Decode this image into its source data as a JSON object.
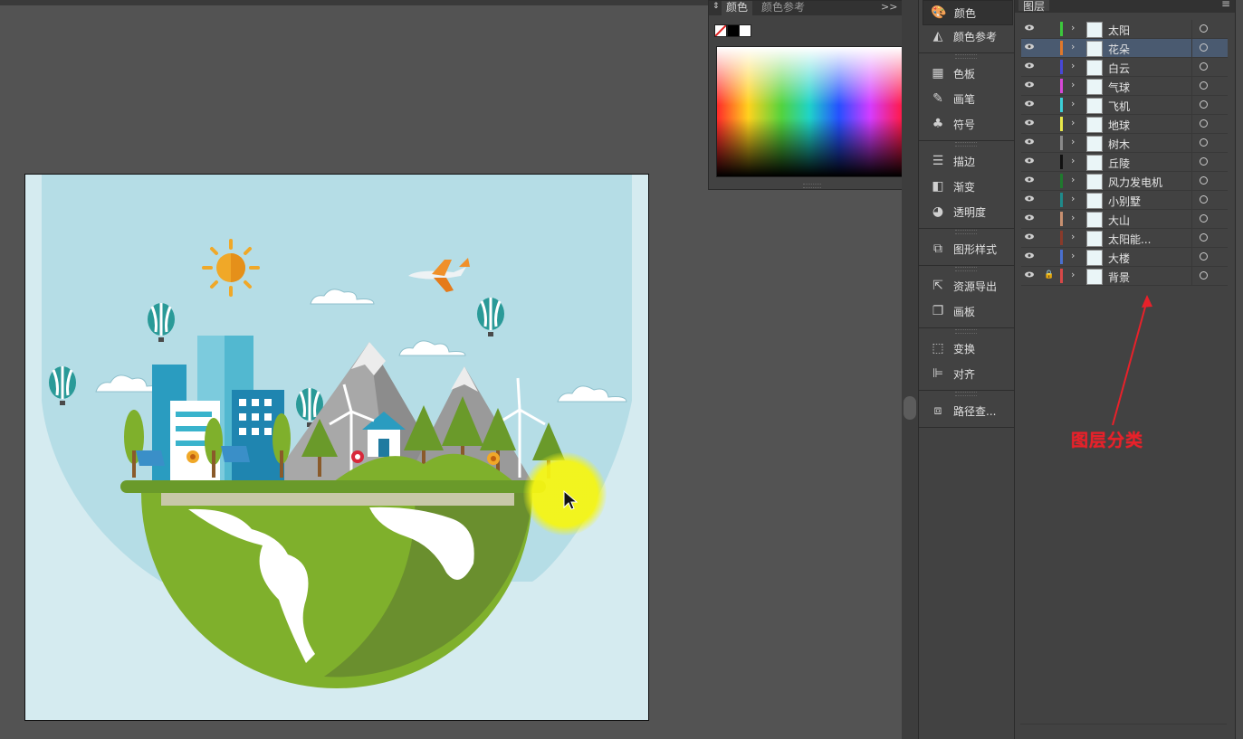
{
  "color_panel": {
    "tab_color": "颜色",
    "tab_color_guide": "颜色参考",
    "expand_glyph": ">>",
    "menu_glyph": "≡"
  },
  "dock": {
    "items": [
      {
        "label": "颜色",
        "icon": "palette-icon"
      },
      {
        "label": "颜色参考",
        "icon": "color-guide-icon"
      },
      {
        "label": "色板",
        "icon": "swatches-icon"
      },
      {
        "label": "画笔",
        "icon": "brush-icon"
      },
      {
        "label": "符号",
        "icon": "symbol-club-icon"
      },
      {
        "label": "描边",
        "icon": "stroke-icon"
      },
      {
        "label": "渐变",
        "icon": "gradient-icon"
      },
      {
        "label": "透明度",
        "icon": "transparency-icon"
      },
      {
        "label": "图形样式",
        "icon": "graphic-styles-icon"
      },
      {
        "label": "资源导出",
        "icon": "asset-export-icon"
      },
      {
        "label": "画板",
        "icon": "artboards-icon"
      },
      {
        "label": "变换",
        "icon": "transform-icon"
      },
      {
        "label": "对齐",
        "icon": "align-icon"
      },
      {
        "label": "路径查...",
        "icon": "pathfinder-icon"
      }
    ]
  },
  "layers_panel": {
    "title": "图层",
    "menu_glyph": "≡",
    "layers": [
      {
        "name": "太阳",
        "color": "#3cc83c",
        "selected": false,
        "locked": false
      },
      {
        "name": "花朵",
        "color": "#e0782a",
        "selected": true,
        "locked": false
      },
      {
        "name": "白云",
        "color": "#4848d8",
        "selected": false,
        "locked": false
      },
      {
        "name": "气球",
        "color": "#d848d8",
        "selected": false,
        "locked": false
      },
      {
        "name": "飞机",
        "color": "#3cd0d8",
        "selected": false,
        "locked": false
      },
      {
        "name": "地球",
        "color": "#e8e84a",
        "selected": false,
        "locked": false
      },
      {
        "name": "树木",
        "color": "#8a8a8a",
        "selected": false,
        "locked": false
      },
      {
        "name": "丘陵",
        "color": "#111111",
        "selected": false,
        "locked": false
      },
      {
        "name": "风力发电机",
        "color": "#1f7a2e",
        "selected": false,
        "locked": false
      },
      {
        "name": "小别墅",
        "color": "#1f8a8a",
        "selected": false,
        "locked": false
      },
      {
        "name": "大山",
        "color": "#c89070",
        "selected": false,
        "locked": false
      },
      {
        "name": "太阳能...",
        "color": "#8a3a2a",
        "selected": false,
        "locked": false
      },
      {
        "name": "大楼",
        "color": "#4a70d0",
        "selected": false,
        "locked": false
      },
      {
        "name": "背景",
        "color": "#d84848",
        "selected": false,
        "locked": true
      }
    ]
  },
  "annotation": {
    "text": "图层分类",
    "color": "#e8212a"
  },
  "colors": {
    "workspace": "#535353",
    "panel": "#424242",
    "sky": "#b5dde6",
    "earth": "#7fb02c",
    "sun": "#f0a828"
  }
}
